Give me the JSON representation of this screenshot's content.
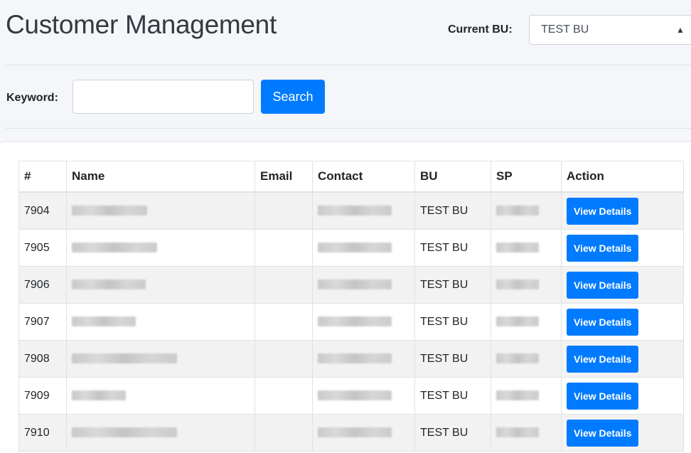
{
  "page": {
    "title": "Customer Management"
  },
  "bu": {
    "label": "Current BU:",
    "selected": "TEST BU"
  },
  "search": {
    "label": "Keyword:",
    "value": "",
    "placeholder": "",
    "button_label": "Search"
  },
  "table": {
    "headers": [
      "#",
      "Name",
      "Email",
      "Contact",
      "BU",
      "SP",
      "Action"
    ],
    "rows": [
      {
        "id": "7904",
        "name": "",
        "email": "",
        "contact": "",
        "bu": "TEST BU",
        "sp": "",
        "action": "View Details"
      },
      {
        "id": "7905",
        "name": "",
        "email": "",
        "contact": "",
        "bu": "TEST BU",
        "sp": "",
        "action": "View Details"
      },
      {
        "id": "7906",
        "name": "",
        "email": "",
        "contact": "",
        "bu": "TEST BU",
        "sp": "",
        "action": "View Details"
      },
      {
        "id": "7907",
        "name": "",
        "email": "",
        "contact": "",
        "bu": "TEST BU",
        "sp": "",
        "action": "View Details"
      },
      {
        "id": "7908",
        "name": "",
        "email": "",
        "contact": "",
        "bu": "TEST BU",
        "sp": "",
        "action": "View Details"
      },
      {
        "id": "7909",
        "name": "",
        "email": "",
        "contact": "",
        "bu": "TEST BU",
        "sp": "",
        "action": "View Details"
      },
      {
        "id": "7910",
        "name": "",
        "email": "",
        "contact": "",
        "bu": "TEST BU",
        "sp": "",
        "action": "View Details"
      }
    ]
  },
  "icons": {
    "select_caret": "sort-caret-icon"
  },
  "colors": {
    "primary": "#007bff",
    "background": "#f4f6f9",
    "row_stripe": "#f2f2f2",
    "border": "#dee2e6"
  }
}
